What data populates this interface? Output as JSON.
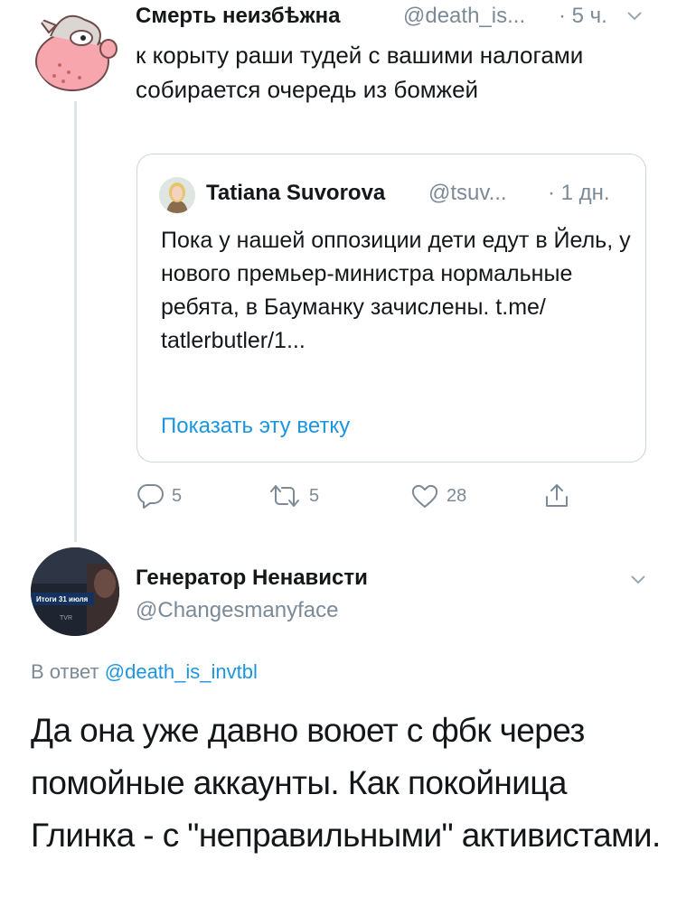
{
  "tweet1": {
    "author_name": "Смерть неизбѣжна",
    "handle": "@death_is...",
    "time": "· 5 ч.",
    "text": "к корыту раши тудей с вашими налогами собирается очередь из бомжей",
    "quoted": {
      "author_name": "Tatiana Suvorova",
      "handle": "@tsuv...",
      "time": "· 1 дн.",
      "text": "Пока у нашей оппозиции дети едут в Йель, у нового премьер-министра нормальные ребята, в Бауманку зачислены. t.me/ tatlerbutler/1...",
      "show_thread": "Показать эту ветку"
    },
    "actions": {
      "replies": "5",
      "retweets": "5",
      "likes": "28"
    }
  },
  "tweet2": {
    "author_name": "Генератор Ненависти",
    "handle": "@Changesmanyface",
    "avatar_caption": "Итоги 31 июля",
    "avatar_channel": "TVR",
    "reply_prefix": "В ответ",
    "reply_to": "@death_is_invtbl",
    "text": "Да она уже давно воюет с фбк через помойные аккаунты. Как покойница Глинка - с \"неправильными\" активистами."
  },
  "colors": {
    "text": "#14171a",
    "muted": "#7b8a96",
    "link": "#1b95e0",
    "border": "#ccd6dd"
  }
}
